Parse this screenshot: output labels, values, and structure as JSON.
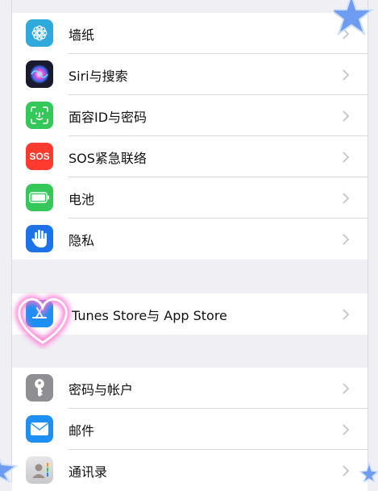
{
  "group1": [
    {
      "label": "墙纸",
      "icon": "flower-icon",
      "color": "#30aadc"
    },
    {
      "label": "Siri与搜索",
      "icon": "siri-icon",
      "color": "#1a1a2e"
    },
    {
      "label": "面容ID与密码",
      "icon": "faceid-icon",
      "color": "#34c759"
    },
    {
      "label": "SOS紧急联络",
      "icon": "sos-icon",
      "color": "#ff3b30",
      "text": "SOS"
    },
    {
      "label": "电池",
      "icon": "battery-icon",
      "color": "#34c759"
    },
    {
      "label": "隐私",
      "icon": "hand-icon",
      "color": "#1e72e8"
    }
  ],
  "group2": [
    {
      "label": "Tunes Store与 App Store",
      "icon": "appstore-icon",
      "color": "#1e8ff4"
    }
  ],
  "group3": [
    {
      "label": "密码与帐户",
      "icon": "key-icon",
      "color": "#8e8e93"
    },
    {
      "label": "邮件",
      "icon": "mail-icon",
      "color": "#1e8ff4"
    },
    {
      "label": "通讯录",
      "icon": "contacts-icon",
      "color": "#c7c7cc"
    }
  ],
  "colors": {
    "background": "#efeff4",
    "separator": "#d8d8dc",
    "chevron": "#c4c4c9",
    "accent_star": "#6e9cf2",
    "heart_glow": "#ff6fd0"
  }
}
